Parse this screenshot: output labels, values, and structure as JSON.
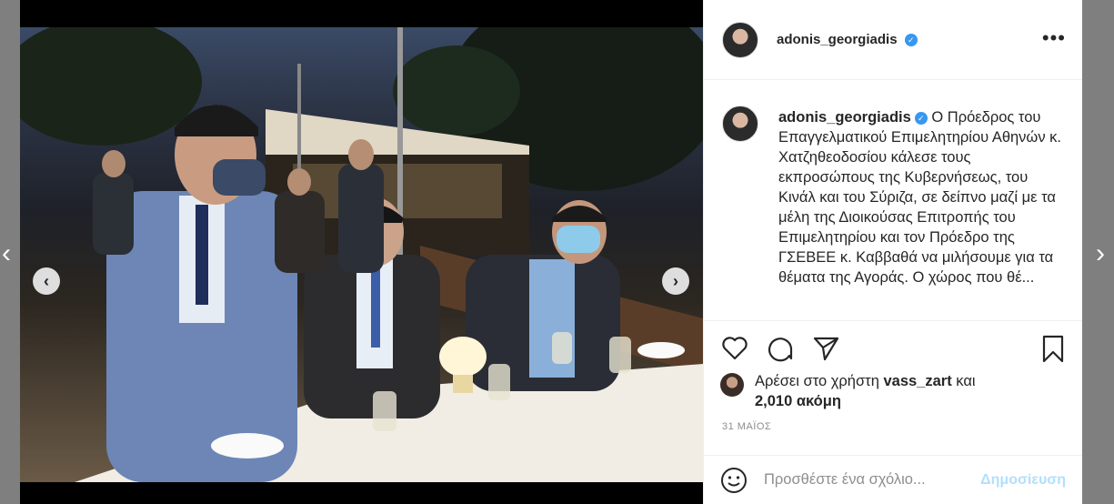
{
  "post": {
    "username": "adonis_georgiadis",
    "caption": "Ο Πρόεδρος του Επαγγελματικού Επιμελητηρίου Αθηνών κ. Χατζηθεοδοσίου κάλεσε τους εκπροσώπους της Κυβερνήσεως, του Κινάλ και του Σύριζα, σε δείπνο μαζί με τα μέλη της Διοικούσας Επιτροπής του Επιμελητηρίου και τον Πρόεδρο της ΓΣΕΒΕΕ κ. Καββαθά να μιλήσουμε για τα θέματα της Αγοράς. Ο χώρος που",
    "caption_cut": "θέ...",
    "likes_prefix": "Αρέσει στο χρήστη",
    "liked_by": "vass_zart",
    "likes_and": "και",
    "likes_count": "2,010 ακόμη",
    "date": "31 ΜΑΪΟΣ"
  },
  "comment": {
    "placeholder": "Προσθέστε ένα σχόλιο...",
    "post_label": "Δημοσίευση"
  },
  "icons": {
    "verified": "verified-badge-icon",
    "more": "more-options-icon",
    "like": "heart-icon",
    "comment": "comment-bubble-icon",
    "share": "paper-plane-icon",
    "save": "bookmark-icon",
    "emoji": "smiley-icon",
    "prev": "chevron-left-icon",
    "next": "chevron-right-icon"
  },
  "colors": {
    "verified": "#3897f0",
    "post_button": "#b2dffc",
    "text": "#262626",
    "muted": "#8e8e8e"
  }
}
